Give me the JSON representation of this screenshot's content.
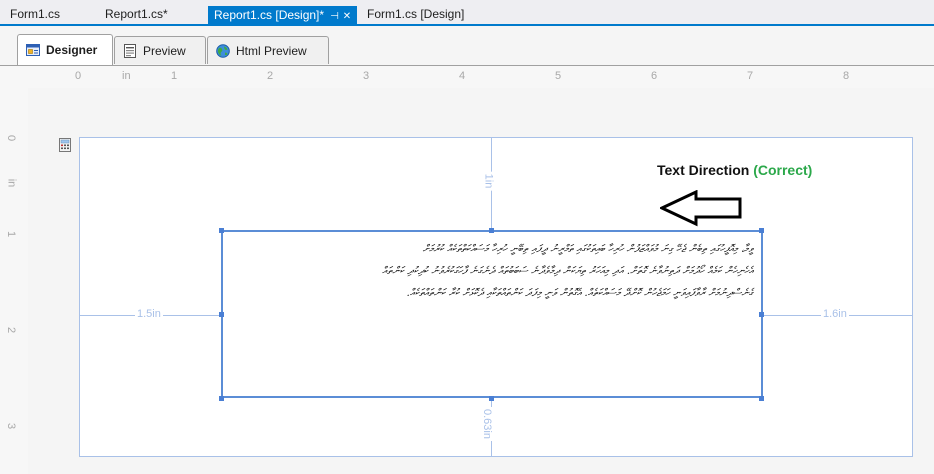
{
  "doc_tabs": [
    {
      "label": "Form1.cs"
    },
    {
      "label": "Report1.cs*"
    },
    {
      "label": "Report1.cs [Design]*",
      "active": true
    },
    {
      "label": "Form1.cs [Design]"
    }
  ],
  "active_tab_pin": "⊣",
  "active_tab_close": "✕",
  "view_tabs": [
    {
      "label": "Designer",
      "icon": "designer-icon",
      "active": true
    },
    {
      "label": "Preview",
      "icon": "preview-icon"
    },
    {
      "label": "Html Preview",
      "icon": "globe-icon"
    }
  ],
  "ruler": {
    "unit": "in",
    "h_numbers": [
      "0",
      "in",
      "1",
      "2",
      "3",
      "4",
      "5",
      "6",
      "7",
      "8"
    ],
    "v_numbers": [
      "0",
      "in",
      "1",
      "2",
      "3"
    ]
  },
  "margins": {
    "top": "1in",
    "left": "1.5in",
    "right": "1.6in",
    "bottom": "0.63in"
  },
  "textbox": {
    "lines": [
      "ވީމާ، މިއޮފީހުގައި ތިބެން ޖެހޭ ގިނަ މުވައްޒަފުން ހުރިހާ ބައިތަކުގައި ތަމްރީނު ދީފައި ތިބޭނީ ހުރިހާ މަސައްކަތްތަކެއް ކުރުމަށް",
      "އެހެނިހެން ކަމެއް ހޯދުމަށް ދަތިނުވާނެ ގޮތަށް. އަދި މިއަހަރު ތިޔަކަން ދިމާވެދާނެ ސަބަބުތައް ދެނެގަނެ ފާހަގަކުރެވުނު ކުދިކުދި ކަންތައް",
      "ގެނެސްދިނުމަށް ރާވާފައިވަނީ ހަމަޖެހުން ކޮށްދޭ މަސައްކަތެއް. އެގޮތުން ވަނީ މިފަދަ ކަންތައްތަކާއި ދެކޮޅަށް ކުރާ ކަންތައްތަކެއް."
    ]
  },
  "annotation": {
    "label": "Text Direction",
    "status": "(Correct)",
    "status_color": "#2ba84a"
  }
}
